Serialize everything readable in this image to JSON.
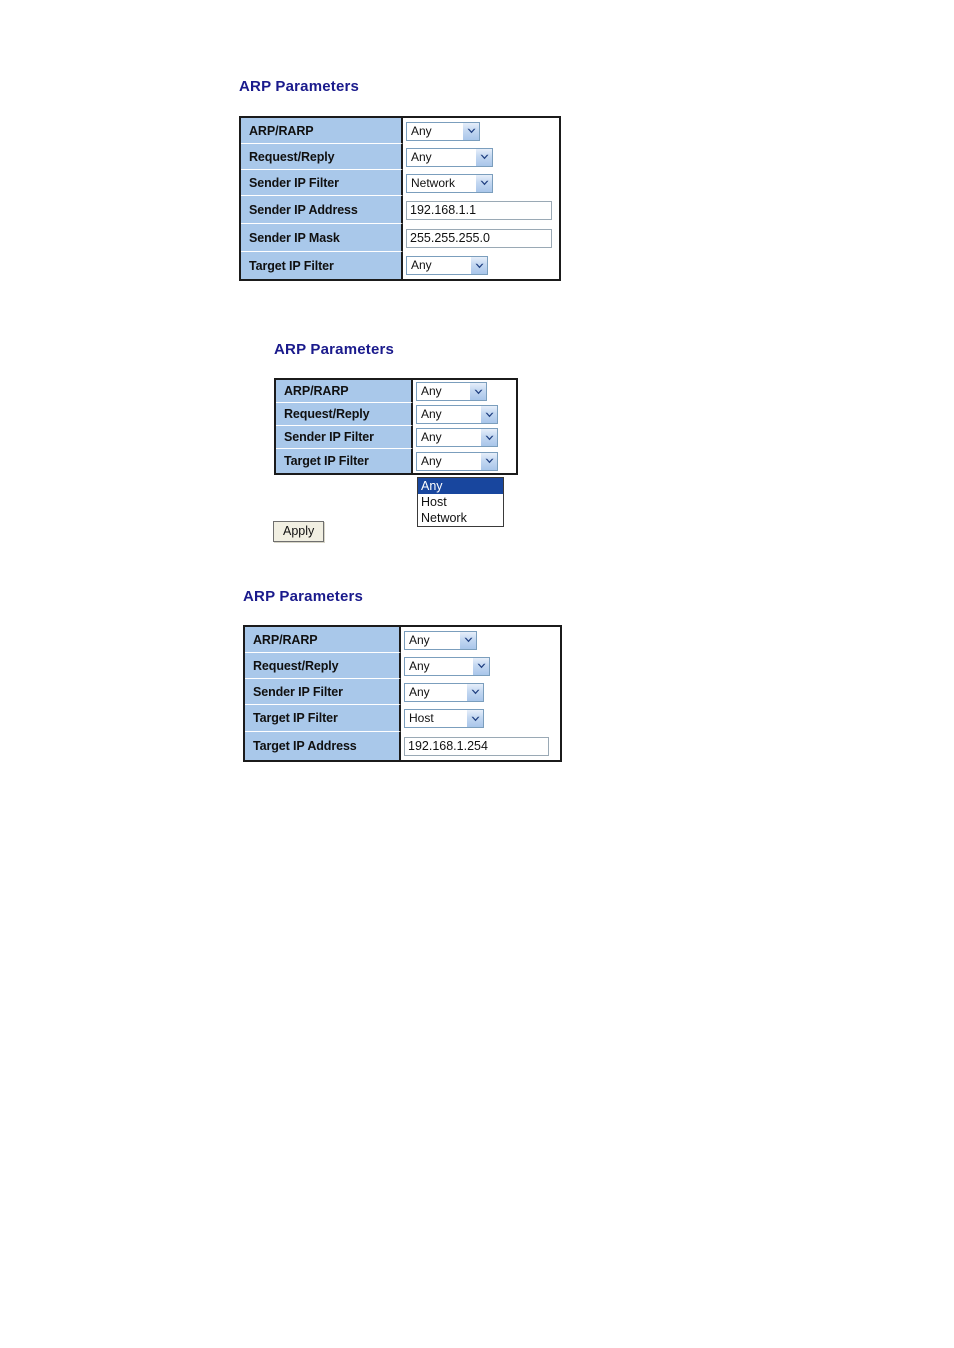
{
  "page": {
    "background_color": "#ffffff",
    "title_color": "#1a1a8c",
    "label_cell_color": "#a9c8ea",
    "highlight_color": "#18469e"
  },
  "sections": [
    {
      "title": "ARP Parameters",
      "rows": [
        {
          "label": "ARP/RARP",
          "control": "select",
          "value": "Any"
        },
        {
          "label": "Request/Reply",
          "control": "select",
          "value": "Any"
        },
        {
          "label": "Sender IP Filter",
          "control": "select",
          "value": "Network"
        },
        {
          "label": "Sender IP Address",
          "control": "text",
          "value": "192.168.1.1"
        },
        {
          "label": "Sender IP Mask",
          "control": "text",
          "value": "255.255.255.0"
        },
        {
          "label": "Target IP Filter",
          "control": "select",
          "value": "Any"
        }
      ]
    },
    {
      "title": "ARP Parameters",
      "rows": [
        {
          "label": "ARP/RARP",
          "control": "select",
          "value": "Any"
        },
        {
          "label": "Request/Reply",
          "control": "select",
          "value": "Any"
        },
        {
          "label": "Sender IP Filter",
          "control": "select",
          "value": "Any"
        },
        {
          "label": "Target IP Filter",
          "control": "select",
          "value": "Any"
        }
      ],
      "open_dropdown": {
        "for_row_label": "Target IP Filter",
        "options": [
          {
            "label": "Any",
            "selected": true
          },
          {
            "label": "Host",
            "selected": false
          },
          {
            "label": "Network",
            "selected": false
          }
        ]
      },
      "apply_button_label": "Apply"
    },
    {
      "title": "ARP Parameters",
      "rows": [
        {
          "label": "ARP/RARP",
          "control": "select",
          "value": "Any"
        },
        {
          "label": "Request/Reply",
          "control": "select",
          "value": "Any"
        },
        {
          "label": "Sender IP Filter",
          "control": "select",
          "value": "Any"
        },
        {
          "label": "Target IP Filter",
          "control": "select",
          "value": "Host"
        },
        {
          "label": "Target IP Address",
          "control": "text",
          "value": "192.168.1.254"
        }
      ]
    }
  ]
}
